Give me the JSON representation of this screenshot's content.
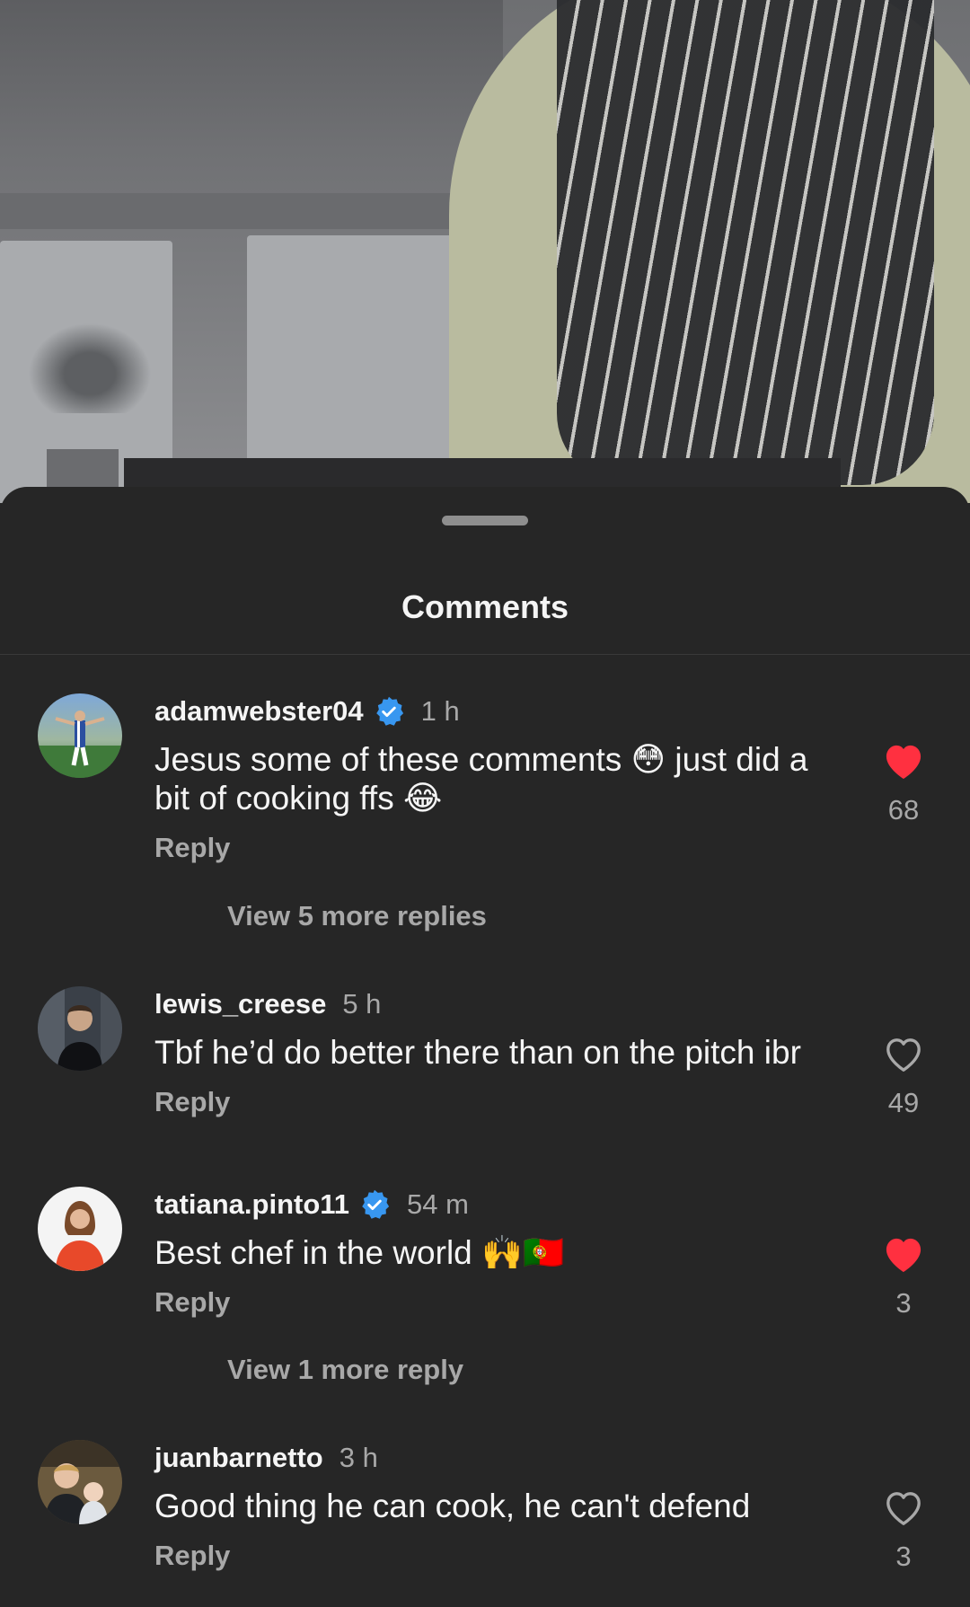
{
  "sheet": {
    "title": "Comments"
  },
  "comments": [
    {
      "username": "adamwebster04",
      "verified": true,
      "time": "1 h",
      "text": "Jesus some of these comments 😳 just did a bit of cooking ffs 😂",
      "reply_label": "Reply",
      "likes": "68",
      "liked": true,
      "view_replies": "View 5 more replies"
    },
    {
      "username": "lewis_creese",
      "verified": false,
      "time": "5 h",
      "text": "Tbf he’d do better there than on the pitch ibr",
      "reply_label": "Reply",
      "likes": "49",
      "liked": false
    },
    {
      "username": "tatiana.pinto11",
      "verified": true,
      "time": "54 m",
      "text": "Best chef in the world 🙌🇵🇹",
      "reply_label": "Reply",
      "likes": "3",
      "liked": true,
      "view_replies": "View 1 more reply"
    },
    {
      "username": "juanbarnetto",
      "verified": false,
      "time": "3 h",
      "text": "Good thing he can cook, he can't defend",
      "reply_label": "Reply",
      "likes": "3",
      "liked": false
    }
  ],
  "colors": {
    "like_active": "#ff3040",
    "verified": "#3897f0",
    "background": "#262626"
  },
  "icons": {
    "like": "heart-icon",
    "verified": "verified-badge-icon"
  }
}
